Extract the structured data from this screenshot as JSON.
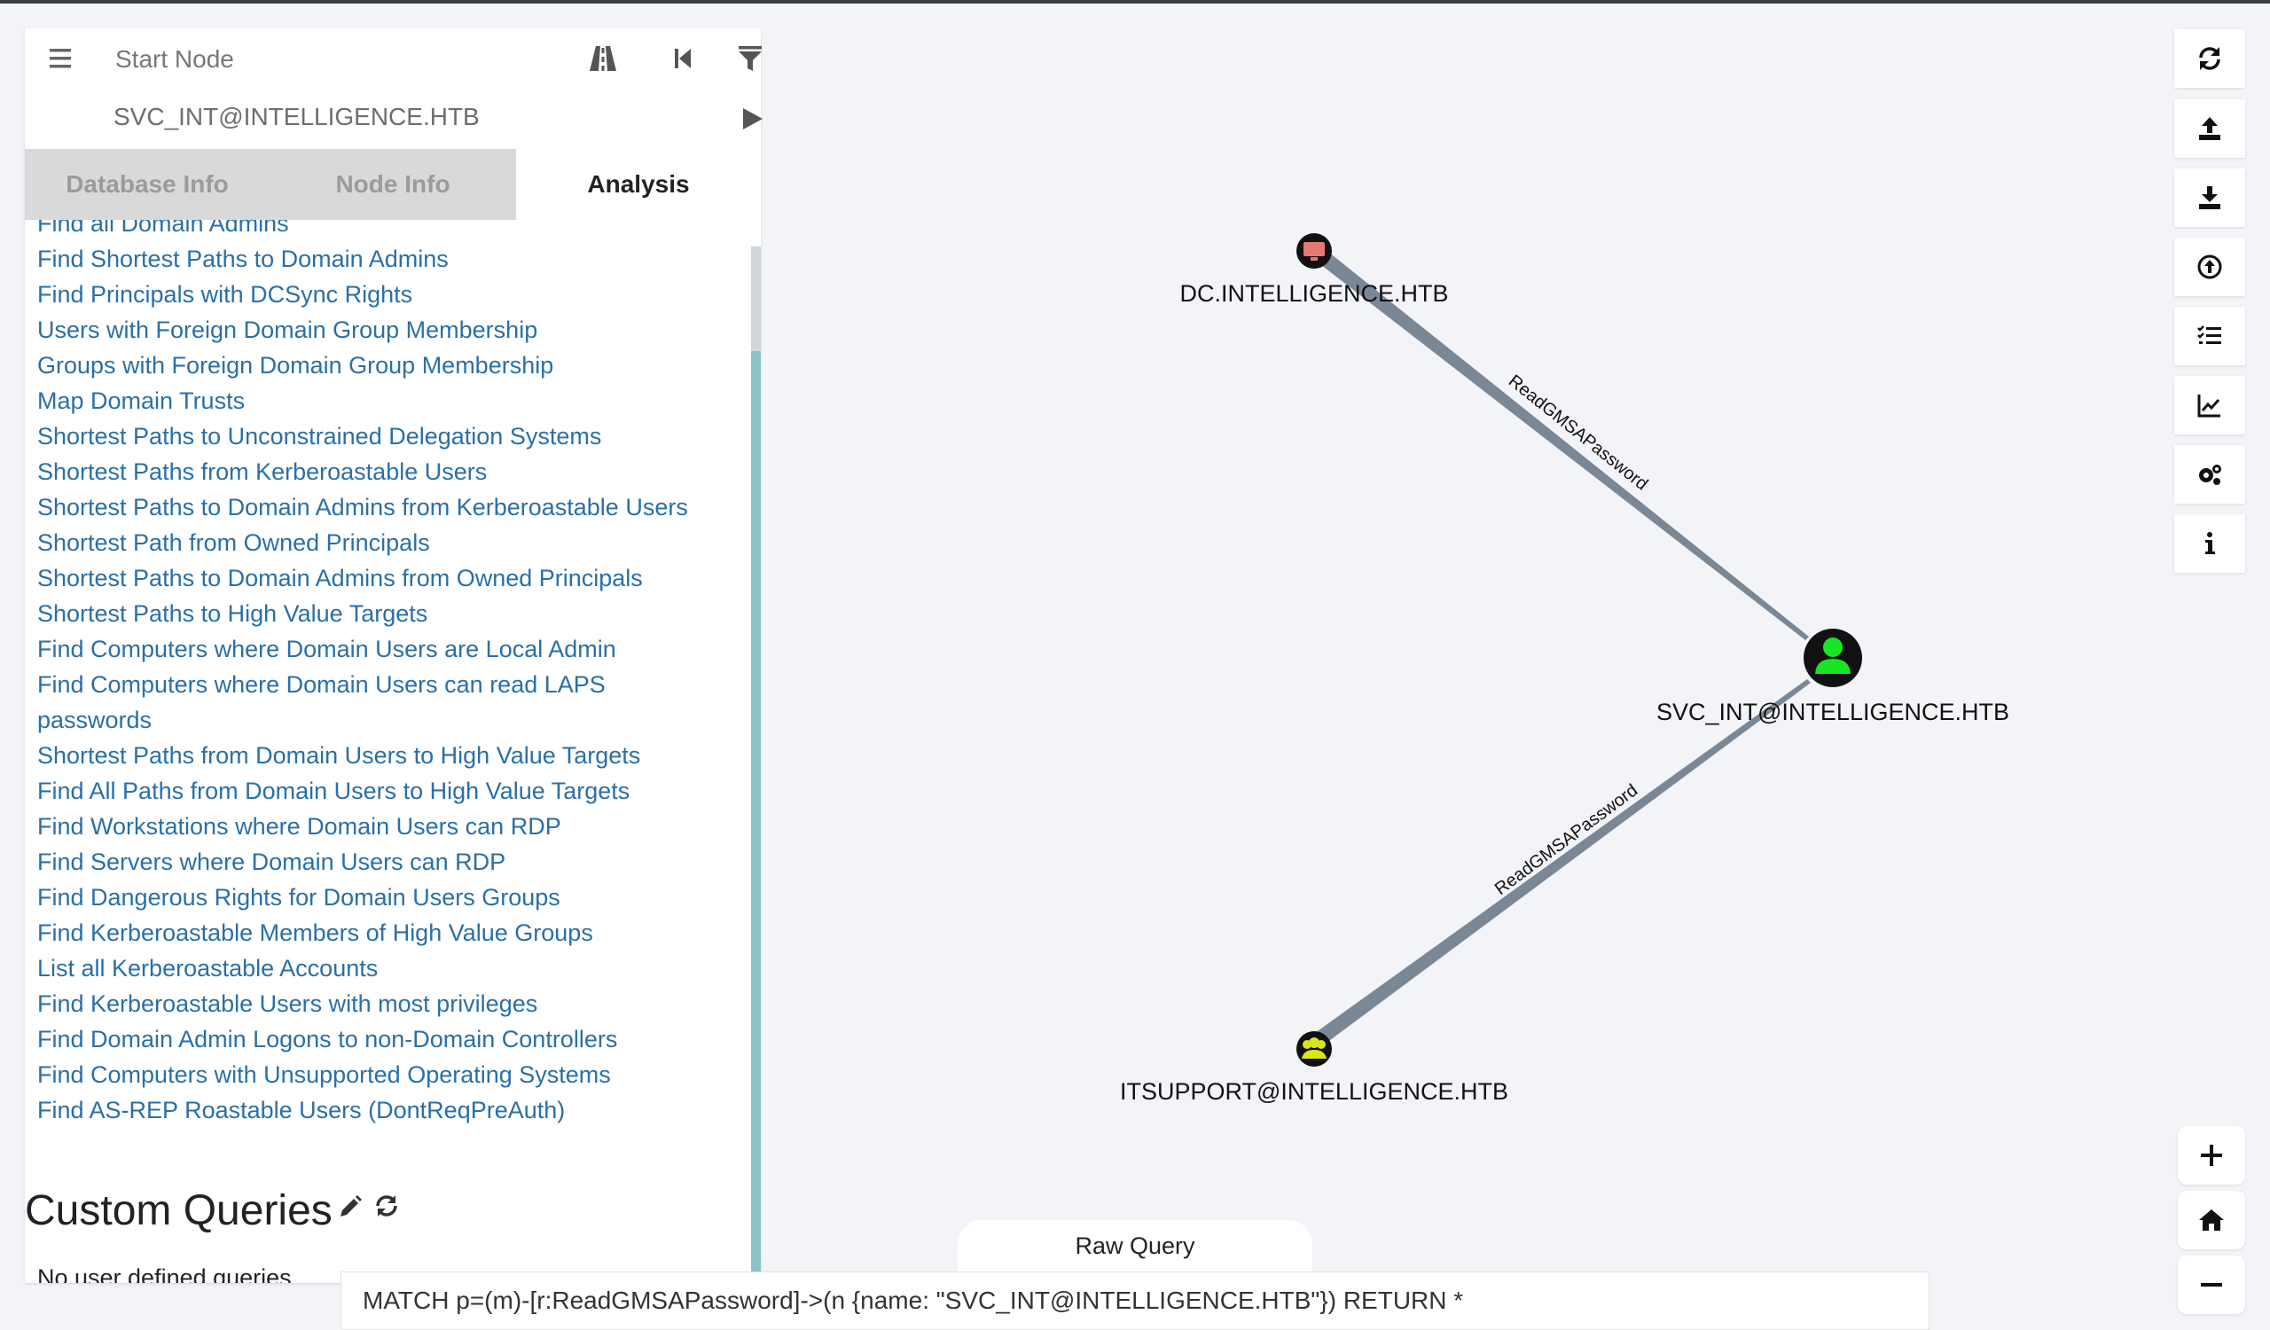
{
  "search": {
    "start_placeholder": "Start Node",
    "start_value": "SVC_INT@INTELLIGENCE.HTB"
  },
  "tabs": [
    {
      "label": "Database Info",
      "active": false
    },
    {
      "label": "Node Info",
      "active": false
    },
    {
      "label": "Analysis",
      "active": true
    }
  ],
  "queries": [
    "Find all Domain Admins",
    "Find Shortest Paths to Domain Admins",
    "Find Principals with DCSync Rights",
    "Users with Foreign Domain Group Membership",
    "Groups with Foreign Domain Group Membership",
    "Map Domain Trusts",
    "Shortest Paths to Unconstrained Delegation Systems",
    "Shortest Paths from Kerberoastable Users",
    "Shortest Paths to Domain Admins from Kerberoastable Users",
    "Shortest Path from Owned Principals",
    "Shortest Paths to Domain Admins from Owned Principals",
    "Shortest Paths to High Value Targets",
    "Find Computers where Domain Users are Local Admin",
    "Find Computers where Domain Users can read LAPS passwords",
    "Shortest Paths from Domain Users to High Value Targets",
    "Find All Paths from Domain Users to High Value Targets",
    "Find Workstations where Domain Users can RDP",
    "Find Servers where Domain Users can RDP",
    "Find Dangerous Rights for Domain Users Groups",
    "Find Kerberoastable Members of High Value Groups",
    "List all Kerberoastable Accounts",
    "Find Kerberoastable Users with most privileges",
    "Find Domain Admin Logons to non-Domain Controllers",
    "Find Computers with Unsupported Operating Systems",
    "Find AS-REP Roastable Users (DontReqPreAuth)"
  ],
  "custom": {
    "title": "Custom Queries",
    "empty_text": "No user defined queries."
  },
  "graph": {
    "nodes": {
      "dc": "DC.INTELLIGENCE.HTB",
      "svc": "SVC_INT@INTELLIGENCE.HTB",
      "itsupport": "ITSUPPORT@INTELLIGENCE.HTB"
    },
    "edges": {
      "top": "ReadGMSAPassword",
      "bottom": "ReadGMSAPassword"
    },
    "colors": {
      "user": "#17e625",
      "group": "#dbe617",
      "computer": "#e67873",
      "edge": "#7a8896"
    }
  },
  "raw_query": {
    "tab_label": "Raw Query",
    "value": "MATCH p=(m)-[r:ReadGMSAPassword]->(n {name: \"SVC_INT@INTELLIGENCE.HTB\"}) RETURN *"
  }
}
